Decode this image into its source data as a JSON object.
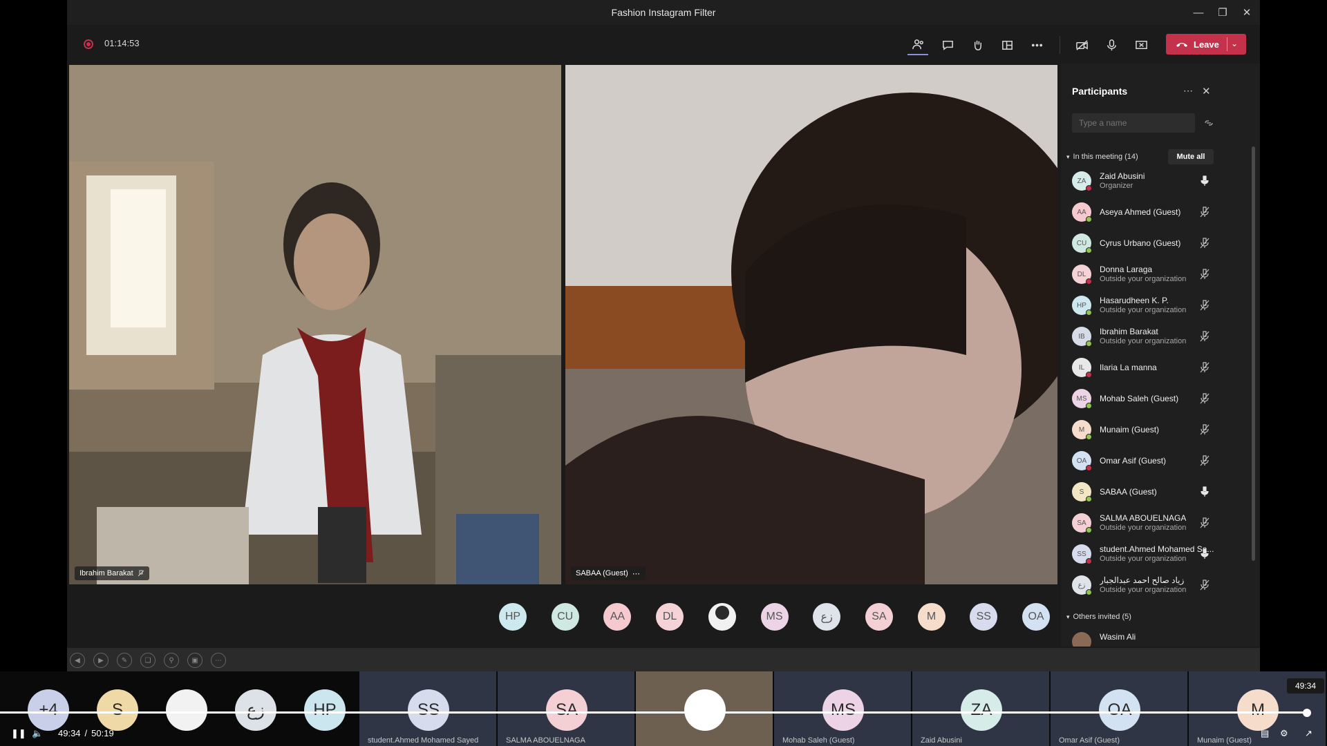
{
  "window": {
    "title": "Fashion Instagram Filter"
  },
  "toolbar": {
    "timer": "01:14:53",
    "leave_label": "Leave"
  },
  "tiles": [
    {
      "name": "Ibrahim Barakat"
    },
    {
      "name": "SABAA (Guest)"
    }
  ],
  "participants": {
    "title": "Participants",
    "search_placeholder": "Type a name",
    "in_meeting_label": "In this meeting (14)",
    "mute_all": "Mute all",
    "others_label": "Others invited (5)",
    "people": [
      {
        "initials": "ZA",
        "name": "Zaid Abusini",
        "sub": "Organizer",
        "color": "#d5ece9",
        "mic": "on"
      },
      {
        "initials": "AA",
        "name": "Aseya Ahmed (Guest)",
        "sub": "",
        "color": "#f6c9cf",
        "mic": "off"
      },
      {
        "initials": "CU",
        "name": "Cyrus Urbano (Guest)",
        "sub": "",
        "color": "#cfe9e2",
        "mic": "off"
      },
      {
        "initials": "DL",
        "name": "Donna Laraga",
        "sub": "Outside your organization",
        "color": "#f4d2d6",
        "mic": "off"
      },
      {
        "initials": "HP",
        "name": "Hasarudheen K. P.",
        "sub": "Outside your organization",
        "color": "#cde8ee",
        "mic": "off"
      },
      {
        "initials": "IB",
        "name": "Ibrahim Barakat",
        "sub": "Outside your organization",
        "color": "#d6dbe8",
        "mic": "off"
      },
      {
        "initials": "IL",
        "name": "Ilaria La manna",
        "sub": "",
        "color": "#e8e8e8",
        "mic": "off"
      },
      {
        "initials": "MS",
        "name": "Mohab Saleh (Guest)",
        "sub": "",
        "color": "#ecd3e6",
        "mic": "off"
      },
      {
        "initials": "M",
        "name": "Munaim (Guest)",
        "sub": "",
        "color": "#f6dccb",
        "mic": "off"
      },
      {
        "initials": "OA",
        "name": "Omar Asif (Guest)",
        "sub": "",
        "color": "#d3e2f2",
        "mic": "off"
      },
      {
        "initials": "S",
        "name": "SABAA (Guest)",
        "sub": "",
        "color": "#f3e6c2",
        "mic": "on"
      },
      {
        "initials": "SA",
        "name": "SALMA ABOUELNAGA",
        "sub": "Outside your organization",
        "color": "#f4cfd4",
        "mic": "off"
      },
      {
        "initials": "SS",
        "name": "student.Ahmed Mohamed Sa...",
        "sub": "Outside your organization",
        "color": "#d6dced",
        "mic": "on"
      },
      {
        "initials": "زع",
        "name": "زياد صالح احمد عبدالجبار",
        "sub": "Outside your organization",
        "color": "#dfe3ea",
        "mic": "off"
      }
    ],
    "invited": [
      {
        "name": "Wasim Ali"
      }
    ]
  },
  "strip": [
    {
      "initials": "HP",
      "color": "#cde8ee"
    },
    {
      "initials": "CU",
      "color": "#cfe9e2"
    },
    {
      "initials": "AA",
      "color": "#f6c9cf"
    },
    {
      "initials": "DL",
      "color": "#f4d2d6"
    },
    {
      "initials": "",
      "color": "#ffffff"
    },
    {
      "initials": "MS",
      "color": "#ecd3e6"
    },
    {
      "initials": "زع",
      "color": "#dfe3ea"
    },
    {
      "initials": "SA",
      "color": "#f4cfd4"
    },
    {
      "initials": "M",
      "color": "#f6dccb"
    },
    {
      "initials": "SS",
      "color": "#d6dced"
    },
    {
      "initials": "OA",
      "color": "#d3e2f2"
    }
  ],
  "filmstrip": {
    "tiles": [
      {
        "initials": "+4",
        "label": ""
      },
      {
        "initials": "S",
        "label": ""
      },
      {
        "initials": "",
        "label": ""
      },
      {
        "initials": "زع",
        "label": ""
      },
      {
        "initials": "HP",
        "label": ""
      },
      {
        "initials": "SS",
        "label": "student.Ahmed Mohamed Sayed"
      },
      {
        "initials": "SA",
        "label": "SALMA ABOUELNAGA"
      },
      {
        "initials": "",
        "label": ""
      },
      {
        "initials": "MS",
        "label": "Mohab Saleh (Guest)"
      },
      {
        "initials": "ZA",
        "label": "Zaid Abusini"
      },
      {
        "initials": "OA",
        "label": "Omar Asif (Guest)"
      },
      {
        "initials": "M",
        "label": "Munaim (Guest)"
      }
    ]
  },
  "player": {
    "current": "49:34",
    "separator": "/",
    "duration": "50:19",
    "tooltip": "49:34",
    "progress_fraction": 0.985
  }
}
